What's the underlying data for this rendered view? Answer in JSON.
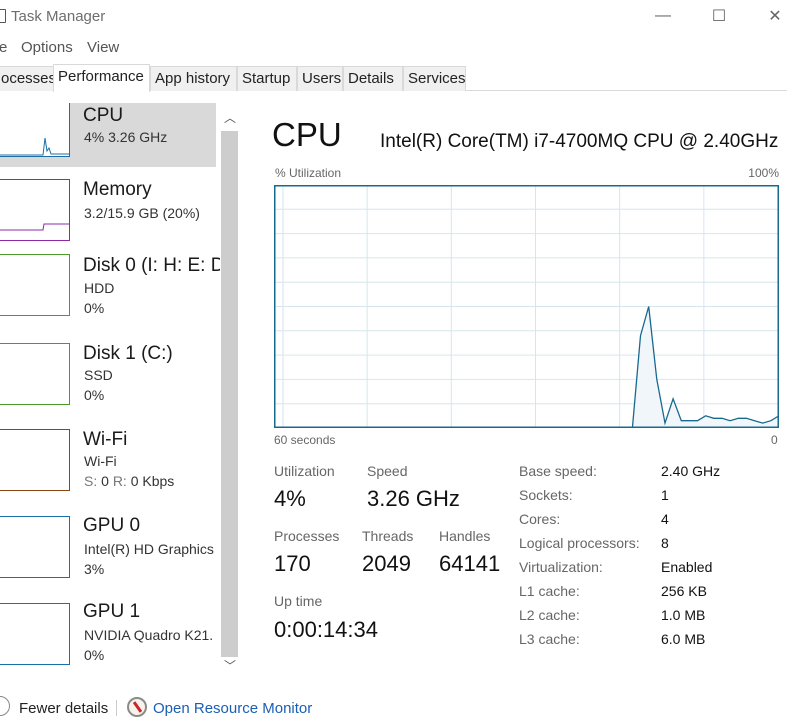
{
  "window": {
    "title": "Task Manager",
    "controls": {
      "minimize": "—",
      "maximize": "☐",
      "close": "✕"
    }
  },
  "menu": {
    "items": [
      "e",
      "Options",
      "View"
    ]
  },
  "tabs": [
    {
      "label": "ocesses",
      "active": false
    },
    {
      "label": "Performance",
      "active": true
    },
    {
      "label": "App history",
      "active": false
    },
    {
      "label": "Startup",
      "active": false
    },
    {
      "label": "Users",
      "active": false
    },
    {
      "label": "Details",
      "active": false
    },
    {
      "label": "Services",
      "active": false
    }
  ],
  "sidebar": {
    "items": [
      {
        "name": "CPU",
        "line1": "4% 3.26 GHz",
        "line2": "",
        "color": "#1c6fa6",
        "selected": true
      },
      {
        "name": "Memory",
        "line1": "3.2/15.9 GB (20%)",
        "line2": "",
        "color": "#8b2ba8",
        "selected": false
      },
      {
        "name": "Disk 0 (I: H: E: D:",
        "line1": "HDD",
        "line2": "0%",
        "color": "#4c9a2a",
        "selected": false
      },
      {
        "name": "Disk 1 (C:)",
        "line1": "SSD",
        "line2": "0%",
        "color": "#4c9a2a",
        "selected": false
      },
      {
        "name": "Wi-Fi",
        "line1": "Wi-Fi",
        "line2_s": "S:",
        "line2_sv": "0",
        "line2_r": "R:",
        "line2_rv": "0 Kbps",
        "color": "#8b4513",
        "selected": false
      },
      {
        "name": "GPU 0",
        "line1": "Intel(R) HD Graphics",
        "line2": "3%",
        "color": "#1c6fa6",
        "selected": false
      },
      {
        "name": "GPU 1",
        "line1": "NVIDIA Quadro K21.",
        "line2": "0%",
        "color": "#1c6fa6",
        "selected": false
      }
    ]
  },
  "main": {
    "title": "CPU",
    "model": "Intel(R) Core(TM) i7-4700MQ CPU @ 2.40GHz",
    "graph": {
      "ylabel": "% Utilization",
      "ymax_label": "100%",
      "xlabel_left": "60 seconds",
      "xlabel_right": "0",
      "line_color": "#17698f",
      "fill_color": "#f1f6fa",
      "grid_color": "#d6e6ee",
      "samples_pct": [
        0,
        0,
        0,
        0,
        0,
        0,
        0,
        0,
        0,
        0,
        0,
        0,
        0,
        0,
        0,
        0,
        0,
        0,
        0,
        0,
        0,
        0,
        0,
        0,
        0,
        0,
        0,
        0,
        0,
        0,
        0,
        0,
        0,
        0,
        0,
        0,
        0,
        0,
        0,
        0,
        0,
        0,
        0,
        0,
        0,
        38,
        50,
        20,
        2,
        12,
        3,
        3,
        3,
        5,
        4,
        4,
        3,
        4,
        4,
        3,
        2,
        3,
        5
      ]
    },
    "stats": {
      "utilization_label": "Utilization",
      "utilization": "4%",
      "speed_label": "Speed",
      "speed": "3.26 GHz",
      "processes_label": "Processes",
      "processes": "170",
      "threads_label": "Threads",
      "threads": "2049",
      "handles_label": "Handles",
      "handles": "64141",
      "uptime_label": "Up time",
      "uptime": "0:00:14:34"
    },
    "info": [
      {
        "label": "Base speed:",
        "value": "2.40 GHz"
      },
      {
        "label": "Sockets:",
        "value": "1"
      },
      {
        "label": "Cores:",
        "value": "4"
      },
      {
        "label": "Logical processors:",
        "value": "8"
      },
      {
        "label": "Virtualization:",
        "value": "Enabled"
      },
      {
        "label": "L1 cache:",
        "value": "256 KB"
      },
      {
        "label": "L2 cache:",
        "value": "1.0 MB"
      },
      {
        "label": "L3 cache:",
        "value": "6.0 MB"
      }
    ]
  },
  "footer": {
    "fewer_details": "Fewer details",
    "open_resource_monitor": "Open Resource Monitor"
  }
}
